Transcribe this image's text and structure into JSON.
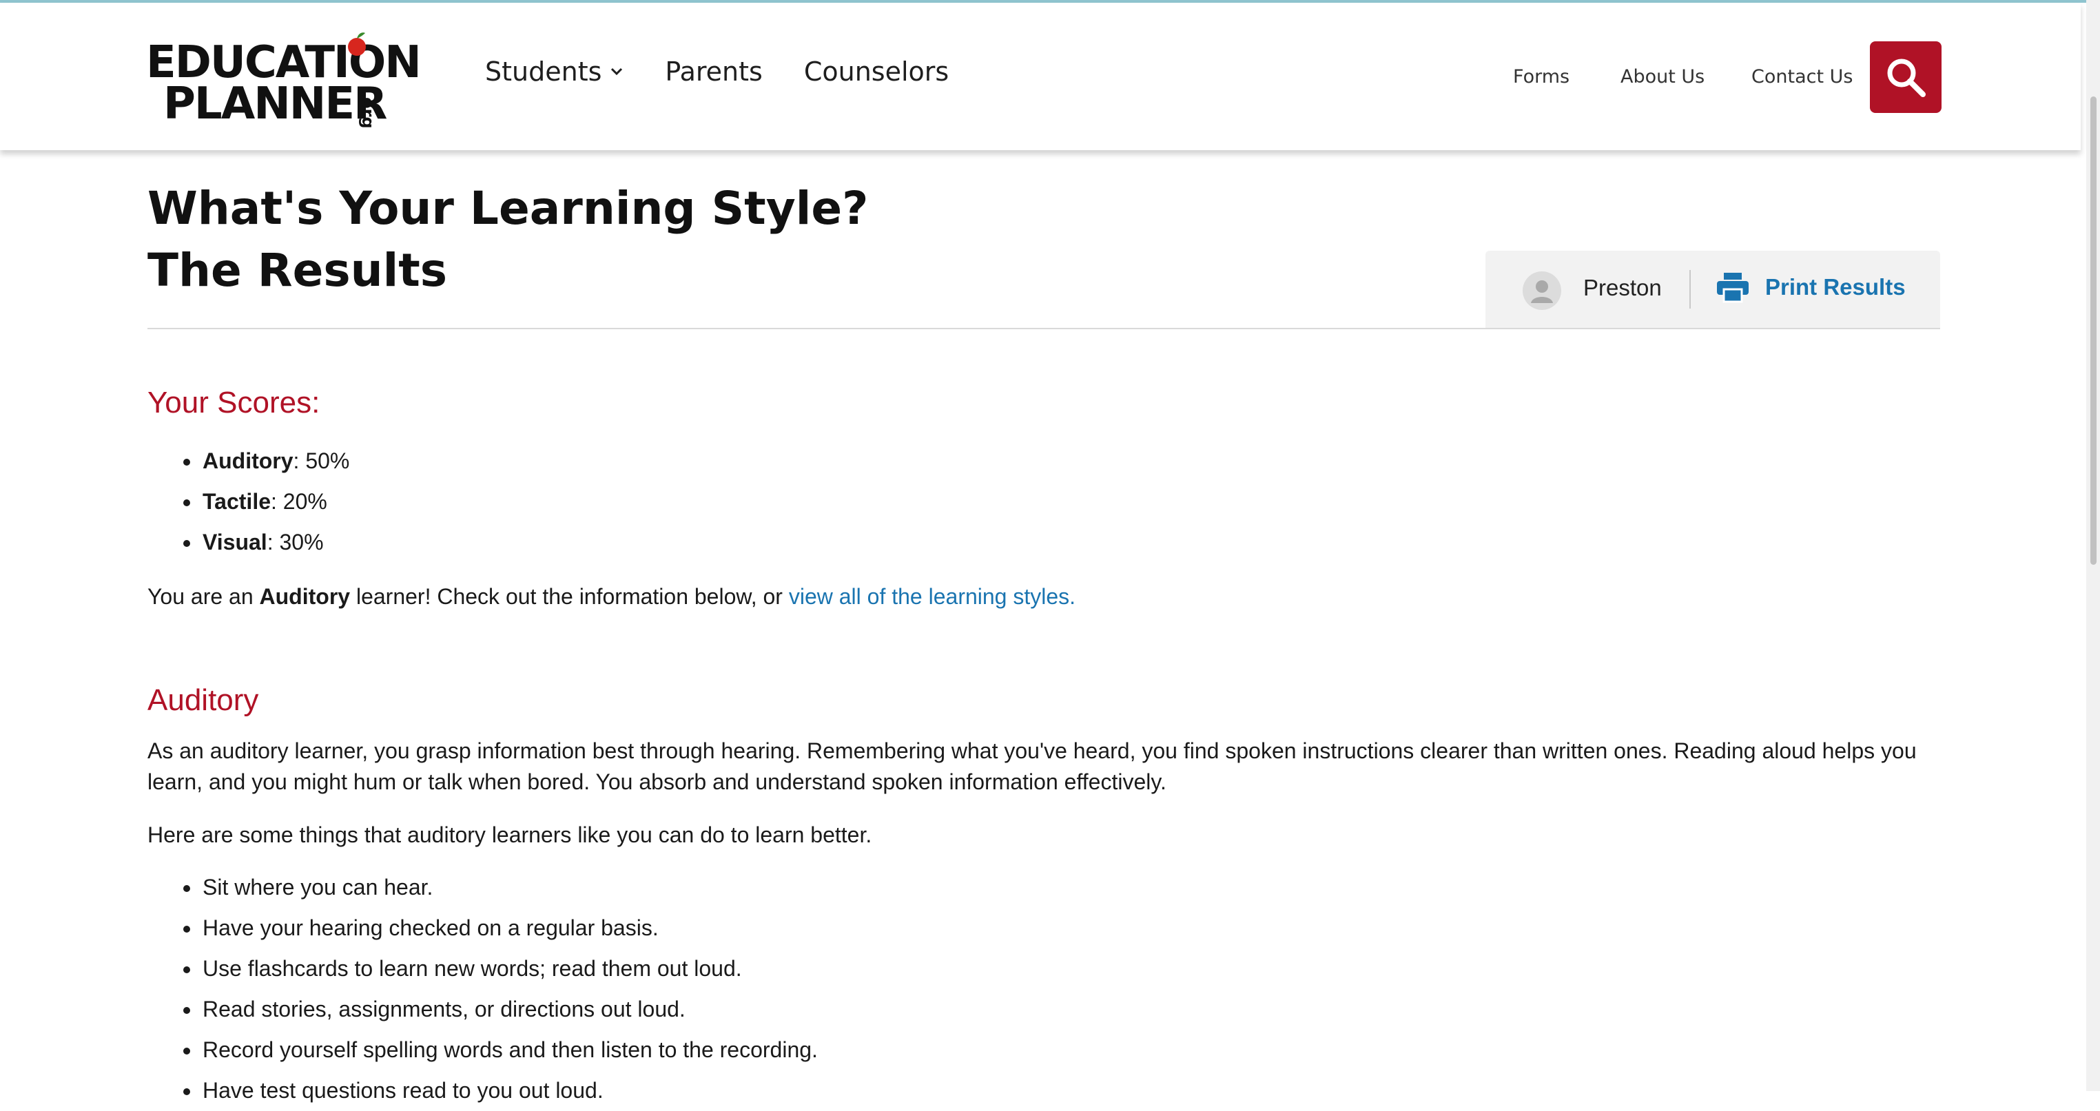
{
  "header": {
    "logo_line1": "EDUCATION",
    "logo_line2": "PLANNER",
    "logo_suffix": ".org",
    "nav_primary": [
      {
        "label": "Students"
      },
      {
        "label": "Parents"
      },
      {
        "label": "Counselors"
      }
    ],
    "nav_secondary": [
      {
        "label": "Forms"
      },
      {
        "label": "About Us"
      },
      {
        "label": "Contact Us"
      }
    ],
    "search_icon": "search-icon",
    "accent_color": "#b01226"
  },
  "page": {
    "title_line1": "What's Your Learning Style?",
    "title_line2": "The Results",
    "user_name": "Preston",
    "print_label": "Print Results",
    "link_color": "#1a74b0"
  },
  "scores": {
    "heading": "Your Scores:",
    "items": [
      {
        "name": "Auditory",
        "value": ": 50%"
      },
      {
        "name": "Tactile",
        "value": ": 20%"
      },
      {
        "name": "Visual",
        "value": ": 30%"
      }
    ],
    "summary_prefix": "You are an ",
    "summary_style": "Auditory",
    "summary_middle": " learner! Check out the information below, or ",
    "summary_link": "view all of the learning styles."
  },
  "auditory": {
    "heading": "Auditory",
    "description": "As an auditory learner, you grasp information best through hearing. Remembering what you've heard, you find spoken instructions clearer than written ones. Reading aloud helps you learn, and you might hum or talk when bored. You absorb and understand spoken information effectively.",
    "tips_intro": "Here are some things that auditory learners like you can do to learn better.",
    "tips": [
      "Sit where you can hear.",
      "Have your hearing checked on a regular basis.",
      "Use flashcards to learn new words; read them out loud.",
      "Read stories, assignments, or directions out loud.",
      "Record yourself spelling words and then listen to the recording.",
      "Have test questions read to you out loud."
    ]
  }
}
